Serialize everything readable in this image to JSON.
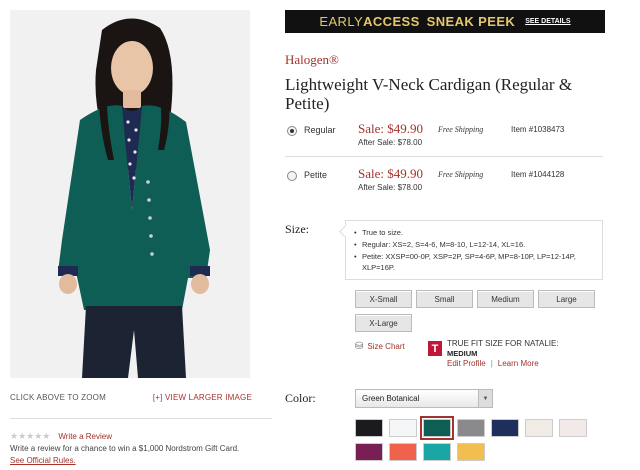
{
  "banner": {
    "early": "EARLY",
    "access": "ACCESS",
    "sneak": "SNEAK PEEK",
    "details": "SEE DETAILS"
  },
  "product": {
    "brand": "Halogen®",
    "title": "Lightweight V-Neck Cardigan (Regular & Petite)"
  },
  "image": {
    "zoom_text": "CLICK ABOVE TO ZOOM",
    "larger_text": "[+] VIEW LARGER IMAGE"
  },
  "review": {
    "stars": "★★★★★",
    "write": "Write a Review",
    "promo": "Write a review for a chance to win a $1,000 Nordstrom Gift Card.",
    "rules": "See Official Rules."
  },
  "variants": [
    {
      "label": "Regular",
      "sale": "Sale: $49.90",
      "after": "After Sale: $78.00",
      "shipping": "Free Shipping",
      "item": "Item #1038473",
      "selected": true
    },
    {
      "label": "Petite",
      "sale": "Sale: $49.90",
      "after": "After Sale: $78.00",
      "shipping": "Free Shipping",
      "item": "Item #1044128",
      "selected": false
    }
  ],
  "size": {
    "label": "Size:",
    "fit_notes": [
      "True to size.",
      "Regular: XS=2, S=4-6, M=8-10, L=12-14, XL=16.",
      "Petite: XXSP=00-0P, XSP=2P, SP=4-6P, MP=8-10P, LP=12-14P, XLP=16P."
    ],
    "options": [
      "X-Small",
      "Small",
      "Medium",
      "Large",
      "X-Large"
    ],
    "chart_label": "Size Chart"
  },
  "truefit": {
    "logo": "T",
    "title": "TRUE FIT SIZE FOR NATALIE:",
    "size": "MEDIUM",
    "edit": "Edit Profile",
    "sep": "|",
    "learn": "Learn More"
  },
  "color": {
    "label": "Color:",
    "selected": "Green Botanical",
    "swatches": [
      {
        "name": "black",
        "color": "#1b1b1e"
      },
      {
        "name": "white-dots",
        "color": "#f4f6f8"
      },
      {
        "name": "green-botanical",
        "color": "#0e5e54",
        "selected": true
      },
      {
        "name": "grey",
        "color": "#8a8a8c"
      },
      {
        "name": "navy",
        "color": "#1f2f5b"
      },
      {
        "name": "ivory",
        "color": "#f1ede6"
      },
      {
        "name": "blush",
        "color": "#f3e9e8"
      },
      {
        "name": "plum-dot",
        "color": "#7a1f55"
      },
      {
        "name": "coral",
        "color": "#f0624c"
      },
      {
        "name": "teal",
        "color": "#1aa6a5"
      },
      {
        "name": "mustard",
        "color": "#f0bf4f"
      }
    ]
  },
  "colors": {
    "accent": "#a3322b",
    "banner_bg": "#111111",
    "banner_text": "#e4c86b"
  }
}
